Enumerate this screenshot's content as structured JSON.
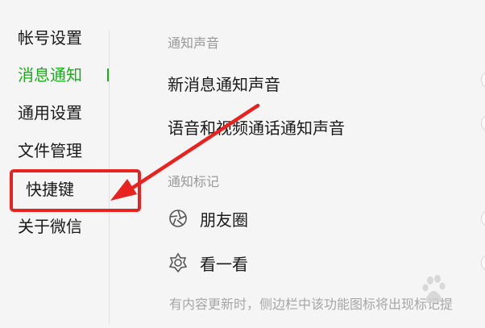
{
  "sidebar": {
    "items": [
      {
        "label": "帐号设置",
        "active": false
      },
      {
        "label": "消息通知",
        "active": true
      },
      {
        "label": "通用设置",
        "active": false
      },
      {
        "label": "文件管理",
        "active": false
      },
      {
        "label": "快捷键",
        "active": false
      },
      {
        "label": "关于微信",
        "active": false
      }
    ]
  },
  "main": {
    "sound_section": {
      "header": "通知声音",
      "settings": [
        {
          "label": "新消息通知声音"
        },
        {
          "label": "语音和视频通话通知声音"
        }
      ]
    },
    "mark_section": {
      "header": "通知标记",
      "items": [
        {
          "label": "朋友圈",
          "icon": "moments-aperture-icon"
        },
        {
          "label": "看一看",
          "icon": "top-stories-icon"
        }
      ],
      "footnote": "有内容更新时，侧边栏中该功能图标将出现标记提"
    }
  },
  "annotation": {
    "highlight_color": "#e8231f",
    "accent_color": "#1aad19"
  },
  "watermark": {
    "text": "Bai 经验",
    "subtext": "jingyan.baidu.com"
  }
}
